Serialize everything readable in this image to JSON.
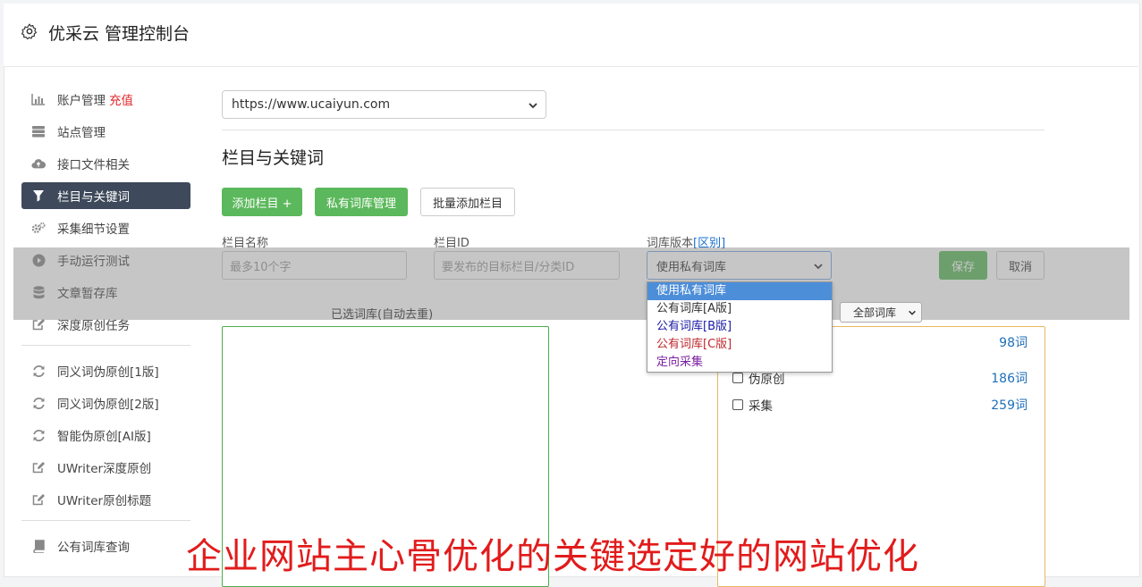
{
  "header": {
    "title": "优采云 管理控制台"
  },
  "sidebar": {
    "items": [
      {
        "label": "账户管理",
        "badge": "充值",
        "icon": "bar-chart-icon"
      },
      {
        "label": "站点管理",
        "icon": "server-icon"
      },
      {
        "label": "接口文件相关",
        "icon": "cloud-upload-icon"
      },
      {
        "label": "栏目与关键词",
        "icon": "filter-icon",
        "active": true
      },
      {
        "label": "采集细节设置",
        "icon": "cogs-icon"
      },
      {
        "label": "手动运行测试",
        "icon": "play-circle-icon"
      },
      {
        "label": "文章暂存库",
        "icon": "database-icon"
      },
      {
        "label": "深度原创任务",
        "icon": "edit-icon"
      },
      {
        "label": "同义词伪原创[1版]",
        "icon": "refresh-icon"
      },
      {
        "label": "同义词伪原创[2版]",
        "icon": "refresh-icon"
      },
      {
        "label": "智能伪原创[AI版]",
        "icon": "refresh-icon"
      },
      {
        "label": "UWriter深度原创",
        "icon": "edit-icon"
      },
      {
        "label": "UWriter原创标题",
        "icon": "edit-icon"
      },
      {
        "label": "公有词库查询",
        "icon": "book-icon"
      }
    ]
  },
  "main": {
    "site_select": "https://www.ucaiyun.com",
    "section_title": "栏目与关键词",
    "buttons": {
      "add_column": "添加栏目 +",
      "private_lib": "私有词库管理",
      "batch_add": "批量添加栏目"
    },
    "form": {
      "name_label": "栏目名称",
      "name_placeholder": "最多10个字",
      "id_label": "栏目ID",
      "id_placeholder": "要发布的目标栏目/分类ID",
      "version_label": "词库版本",
      "version_link": "[区别]",
      "version_value": "使用私有词库",
      "save": "保存",
      "cancel": "取消"
    },
    "dropdown_options": [
      {
        "label": "使用私有词库",
        "color": "#ffffff",
        "selected": true
      },
      {
        "label": "公有词库[A版]",
        "color": "#333333"
      },
      {
        "label": "公有词库[B版]",
        "color": "#1a1aa8"
      },
      {
        "label": "公有词库[C版]",
        "color": "#c0282d"
      },
      {
        "label": "定向采集",
        "color": "#7a1fa0"
      }
    ],
    "chosen_title": "已选词库(自动去重)",
    "lib_filter": "全部词库",
    "libraries": [
      {
        "name": "",
        "count": "98词"
      },
      {
        "name": "伪原创",
        "count": "186词"
      },
      {
        "name": "采集",
        "count": "259词"
      }
    ]
  },
  "banner": "企业网站主心骨优化的关键选定好的网站优化"
}
